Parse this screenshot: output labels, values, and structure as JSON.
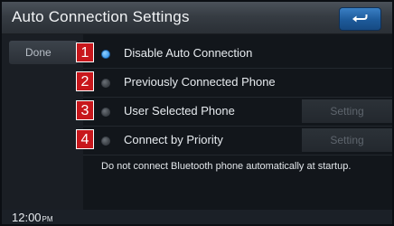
{
  "header": {
    "title": "Auto Connection Settings",
    "back_icon": "return-arrow-icon"
  },
  "sidebar": {
    "done_label": "Done"
  },
  "options": [
    {
      "number": "1",
      "label": "Disable Auto Connection",
      "selected": true
    },
    {
      "number": "2",
      "label": "Previously Connected Phone",
      "selected": false
    },
    {
      "number": "3",
      "label": "User Selected Phone",
      "selected": false,
      "setting_label": "Setting"
    },
    {
      "number": "4",
      "label": "Connect by Priority",
      "selected": false,
      "setting_label": "Setting"
    }
  ],
  "description": "Do not connect Bluetooth phone automatically at startup.",
  "status": {
    "time": "12:00",
    "ampm": "PM"
  },
  "colors": {
    "accent": "#1f86e6",
    "marker": "#c8171c",
    "back_button": "#1d5a9a"
  }
}
